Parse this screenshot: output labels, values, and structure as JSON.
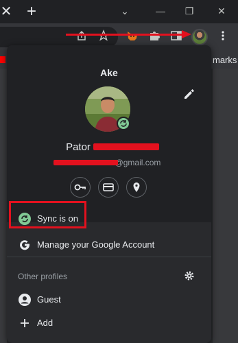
{
  "tabstrip": {
    "close_glyph": "✕",
    "new_tab_glyph": "+",
    "window_controls": [
      "⌄",
      "—",
      "❐",
      "✕"
    ]
  },
  "bookmarks": {
    "label": "marks"
  },
  "profile": {
    "display_name": "Ake",
    "full_name": "Pator",
    "email_suffix": "@gmail.com"
  },
  "menu": {
    "sync": "Sync is on",
    "manage": "Manage your Google Account",
    "other_profiles": "Other profiles",
    "guest": "Guest",
    "add": "Add"
  },
  "icons": {
    "tab_close": "close-icon",
    "new_tab": "plus-icon",
    "share": "share-icon",
    "bookmark": "star-icon",
    "extension_fox": "metamask-icon",
    "extensions": "puzzle-icon",
    "side_panel": "side-panel-icon",
    "menu": "kebab-icon",
    "edit": "pencil-icon",
    "passwords": "key-icon",
    "payments": "credit-card-icon",
    "addresses": "location-pin-icon",
    "sync": "sync-icon",
    "google": "google-g-icon",
    "settings": "gear-icon",
    "guest": "person-icon",
    "add": "plus-icon"
  },
  "colors": {
    "annotation_red": "#e3111e",
    "sync_green": "#81c995",
    "popup_bg": "#292a2d",
    "header_bg": "#202124"
  }
}
